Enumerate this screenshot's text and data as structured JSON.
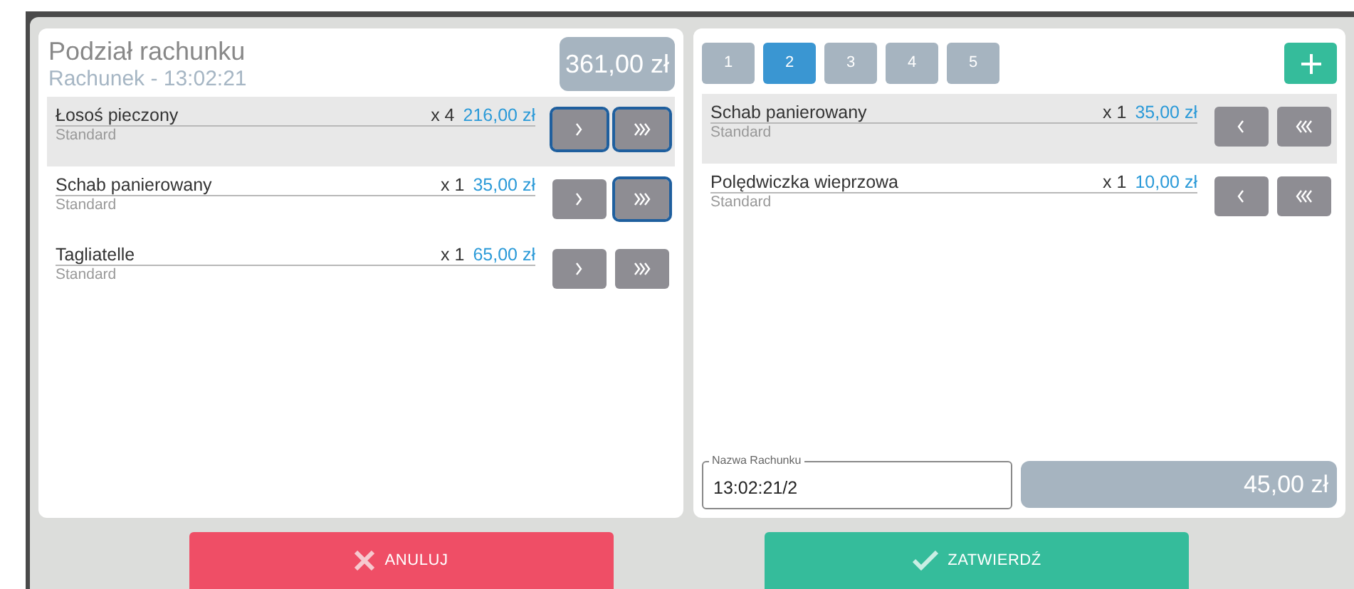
{
  "left_panel": {
    "title": "Podział rachunku",
    "subtitle": "Rachunek - 13:02:21",
    "total": "361,00 zł",
    "items": [
      {
        "name": "Łosoś pieczony",
        "variant": "Standard",
        "qty": "x 4",
        "price": "216,00 zł",
        "selected": true,
        "move_one_focused": true,
        "move_all_focused": true
      },
      {
        "name": "Schab panierowany",
        "variant": "Standard",
        "qty": "x 1",
        "price": "35,00 zł",
        "selected": false,
        "move_one_focused": false,
        "move_all_focused": true
      },
      {
        "name": "Tagliatelle",
        "variant": "Standard",
        "qty": "x 1",
        "price": "65,00 zł",
        "selected": false,
        "move_one_focused": false,
        "move_all_focused": false
      }
    ]
  },
  "right_panel": {
    "tabs": [
      {
        "label": "1",
        "selected": false
      },
      {
        "label": "2",
        "selected": true
      },
      {
        "label": "3",
        "selected": false
      },
      {
        "label": "4",
        "selected": false
      },
      {
        "label": "5",
        "selected": false
      }
    ],
    "items": [
      {
        "name": "Schab panierowany",
        "variant": "Standard",
        "qty": "x 1",
        "price": "35,00 zł",
        "selected": true
      },
      {
        "name": "Polędwiczka wieprzowa",
        "variant": "Standard",
        "qty": "x 1",
        "price": "10,00 zł",
        "selected": false
      }
    ],
    "name_field": {
      "label": "Nazwa Rachunku",
      "value": "13:02:21/2"
    },
    "total": "45,00 zł"
  },
  "buttons": [
    {
      "kind": "cancel",
      "label": "ANULUJ"
    },
    {
      "kind": "confirm",
      "label": "ZATWIERDŹ"
    }
  ]
}
